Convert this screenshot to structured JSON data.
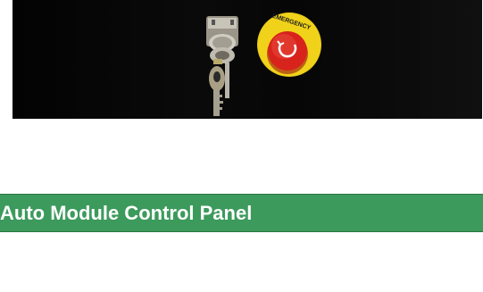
{
  "photo": {
    "alt_subject": "key-switch-and-emergency-stop-button",
    "button_text": "EMERGENCY",
    "colors": {
      "background": "#050505",
      "button_red": "#d8231c",
      "button_yellow": "#f0d21a",
      "key_metal": "#b9b4a6"
    }
  },
  "banner": {
    "title": "Auto Module Control Panel",
    "color": "#3c9a5c"
  }
}
